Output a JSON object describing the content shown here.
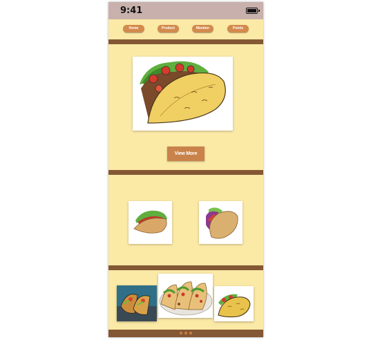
{
  "status_bar": {
    "time": "9:41"
  },
  "nav": {
    "items": [
      "Home",
      "Product",
      "Member",
      "Points"
    ]
  },
  "hero": {
    "button_label": "View More"
  },
  "icons": {
    "hero": "taco-illustration",
    "card_left": "taco-icon",
    "card_right": "taco-icon",
    "carousel": [
      "tacos-on-plate-image",
      "tacos-platter-image",
      "taco-illustration"
    ]
  },
  "pagination": {
    "dots": 3
  },
  "colors": {
    "background": "#fbe9a6",
    "status_bar": "#c8b1ac",
    "divider": "#845834",
    "accent": "#d38a4d"
  }
}
